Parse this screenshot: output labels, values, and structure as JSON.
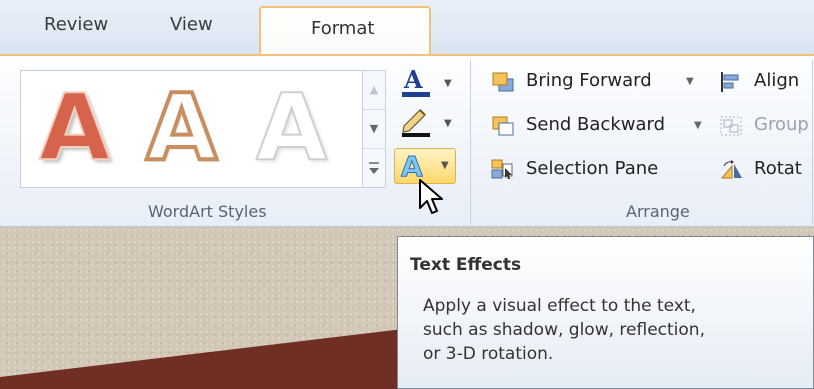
{
  "tabs": {
    "review": "Review",
    "view": "View",
    "format": "Format"
  },
  "wordart": {
    "group_label": "WordArt Styles",
    "samples": [
      "A",
      "A",
      "A"
    ],
    "fill_glyph": "A",
    "effects_glyph": "A"
  },
  "arrange": {
    "group_label": "Arrange",
    "bring_forward": "Bring Forward",
    "send_backward": "Send Backward",
    "selection_pane": "Selection Pane",
    "align": "Align",
    "group": "Group",
    "rotate": "Rotat"
  },
  "tooltip": {
    "title": "Text Effects",
    "line1": "Apply a visual effect to the text,",
    "line2": "such as shadow, glow, reflection,",
    "line3": "or 3-D rotation."
  },
  "colors": {
    "accent_tab_border": "#f2c27a",
    "highlight": "#ffd86a",
    "slide_band": "#6f2f24"
  }
}
